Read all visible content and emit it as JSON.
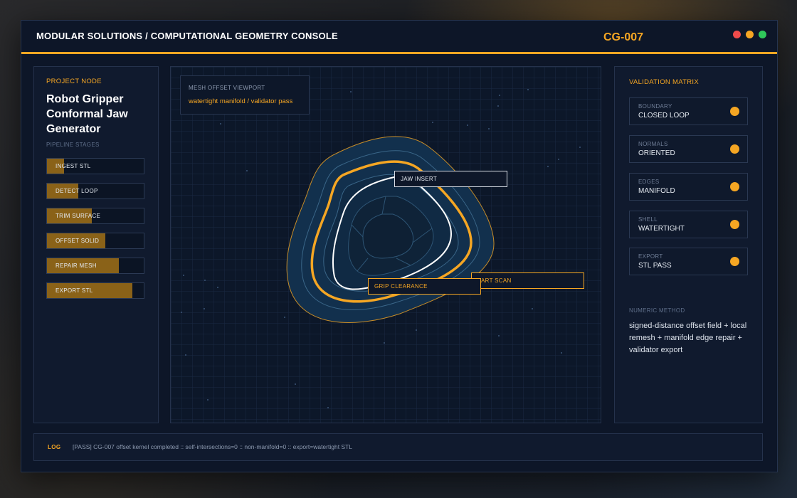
{
  "window": {
    "title": "MODULAR SOLUTIONS / COMPUTATIONAL GEOMETRY CONSOLE",
    "console_id": "CG-007",
    "controls": [
      "close-dot",
      "minimize-dot",
      "maximize-dot"
    ]
  },
  "colors": {
    "accent": "#f5a623",
    "background": "#0d1628",
    "panel": "#101a2e",
    "pass": "#f5a623",
    "close": "#ef4b4b",
    "maximize": "#2fc85a"
  },
  "project": {
    "section_label": "PROJECT NODE",
    "name": "Robot Gripper Conformal Jaw Generator",
    "stages_label": "PIPELINE STAGES",
    "stages": [
      {
        "label": "INGEST STL",
        "progress": 0.18
      },
      {
        "label": "DETECT LOOP",
        "progress": 0.32
      },
      {
        "label": "TRIM SURFACE",
        "progress": 0.46
      },
      {
        "label": "OFFSET SOLID",
        "progress": 0.6
      },
      {
        "label": "REPAIR MESH",
        "progress": 0.74
      },
      {
        "label": "EXPORT STL",
        "progress": 0.88
      }
    ]
  },
  "viewport": {
    "title": "MESH OFFSET VIEWPORT",
    "subtitle": "watertight manifold / validator pass",
    "callouts": {
      "jaw_insert": "JAW INSERT",
      "part_scan": "PART SCAN",
      "grip_clearance": "GRIP CLEARANCE"
    }
  },
  "validation": {
    "section_label": "VALIDATION MATRIX",
    "checks": [
      {
        "key": "BOUNDARY",
        "value": "CLOSED LOOP"
      },
      {
        "key": "NORMALS",
        "value": "ORIENTED"
      },
      {
        "key": "EDGES",
        "value": "MANIFOLD"
      },
      {
        "key": "SHELL",
        "value": "WATERTIGHT"
      },
      {
        "key": "EXPORT",
        "value": "STL PASS"
      }
    ],
    "method_label": "NUMERIC METHOD",
    "method_text": "signed-distance offset field + local remesh + manifold edge repair + validator export"
  },
  "log": {
    "label": "LOG",
    "text": "[PASS] CG-007 offset kernel completed :: self-intersections=0 :: non-manifold=0 :: export=watertight STL"
  }
}
